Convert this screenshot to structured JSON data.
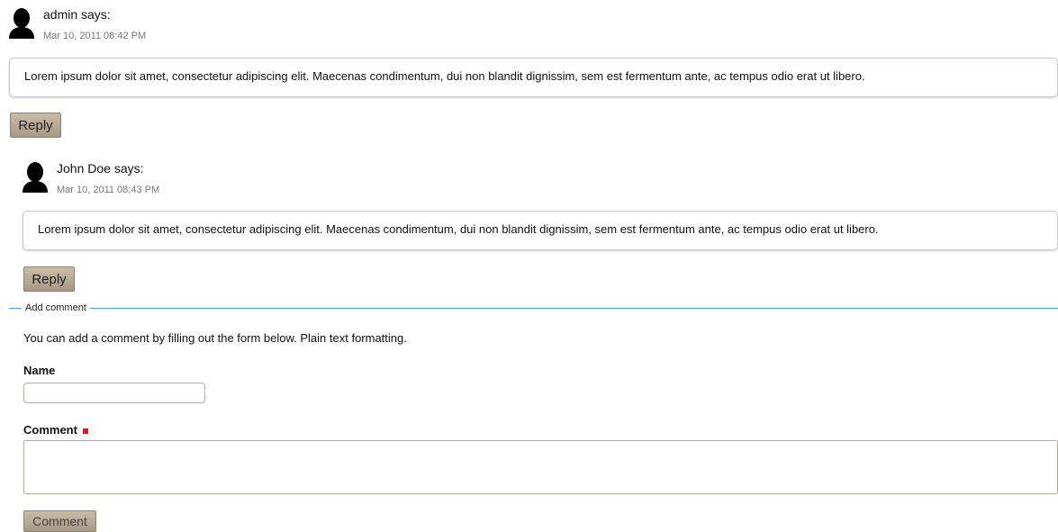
{
  "comments": [
    {
      "author": "admin says:",
      "date": "Mar 10, 2011 08:42 PM",
      "body": "Lorem ipsum dolor sit amet, consectetur adipiscing elit. Maecenas condimentum, dui non blandit dignissim, sem est fermentum ante, ac tempus odio erat ut libero.",
      "reply_label": "Reply"
    },
    {
      "author": "John Doe says:",
      "date": "Mar 10, 2011 08:43 PM",
      "body": "Lorem ipsum dolor sit amet, consectetur adipiscing elit. Maecenas condimentum, dui non blandit dignissim, sem est fermentum ante, ac tempus odio erat ut libero.",
      "reply_label": "Reply"
    }
  ],
  "form": {
    "legend": "Add comment",
    "description": "You can add a comment by filling out the form below. Plain text formatting.",
    "name_label": "Name",
    "name_value": "",
    "comment_label": "Comment",
    "comment_value": "",
    "submit_label": "Comment"
  },
  "colors": {
    "button": "#b3a690",
    "fieldset_line": "#4aa3df",
    "required_marker": "#e31b1b"
  },
  "icons": {
    "avatar": "user-silhouette-icon",
    "required": "required-marker-icon"
  }
}
